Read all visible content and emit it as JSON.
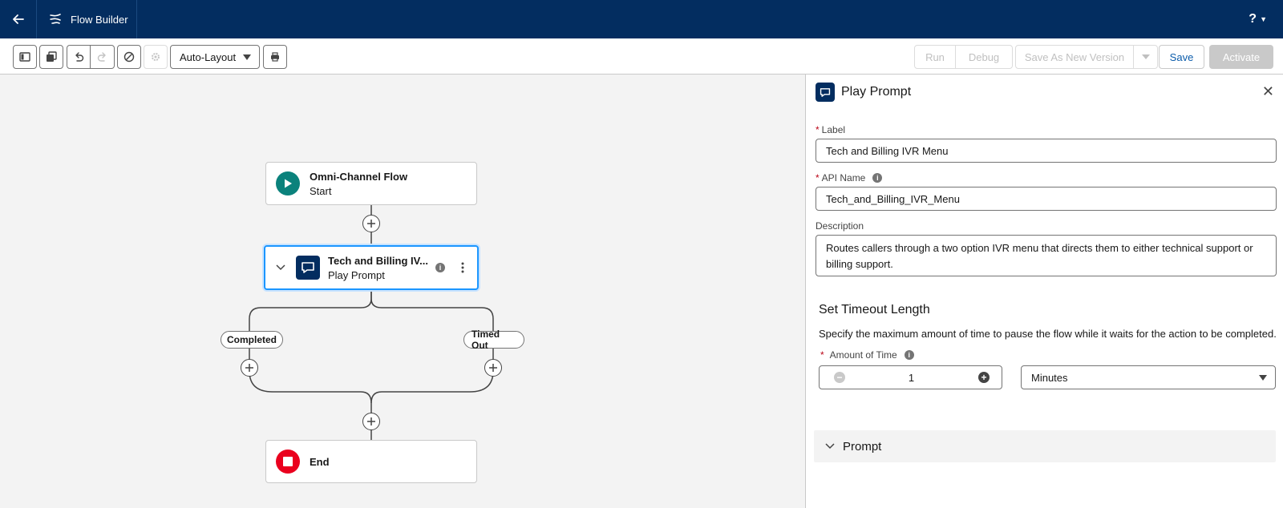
{
  "header": {
    "app_title": "Flow Builder",
    "help_label": "?",
    "back_icon": "arrow-left-icon",
    "brand_icon": "flow-icon"
  },
  "toolbar": {
    "layout_select": "Auto-Layout",
    "run_label": "Run",
    "debug_label": "Debug",
    "save_as_new_label": "Save As New Version",
    "save_label": "Save",
    "activate_label": "Activate"
  },
  "canvas": {
    "start_node": {
      "title": "Omni-Channel Flow",
      "subtitle": "Start"
    },
    "prompt_node": {
      "title": "Tech and Billing IV...",
      "subtitle": "Play Prompt"
    },
    "branches": {
      "left": "Completed",
      "right": "Timed Out"
    },
    "end_node": {
      "title": "End"
    }
  },
  "panel": {
    "title": "Play Prompt",
    "label_field": {
      "label": "Label",
      "value": "Tech and Billing IVR Menu"
    },
    "api_field": {
      "label": "API Name",
      "value": "Tech_and_Billing_IVR_Menu"
    },
    "description_field": {
      "label": "Description",
      "value": "Routes callers through a two option IVR menu that directs them to either technical support or billing support."
    },
    "timeout": {
      "title": "Set Timeout Length",
      "description": "Specify the maximum amount of time to pause the flow while it waits for the action to be completed.",
      "amount_label": "Amount of Time",
      "amount_value": "1",
      "unit_value": "Minutes"
    },
    "prompt_section": "Prompt"
  },
  "colors": {
    "header_bg": "#032d60",
    "start_icon": "#0b827c",
    "end_icon": "#ea001e",
    "prompt_icon": "#032d60",
    "selection": "#1b96ff",
    "brand_blue": "#0b5cab"
  }
}
